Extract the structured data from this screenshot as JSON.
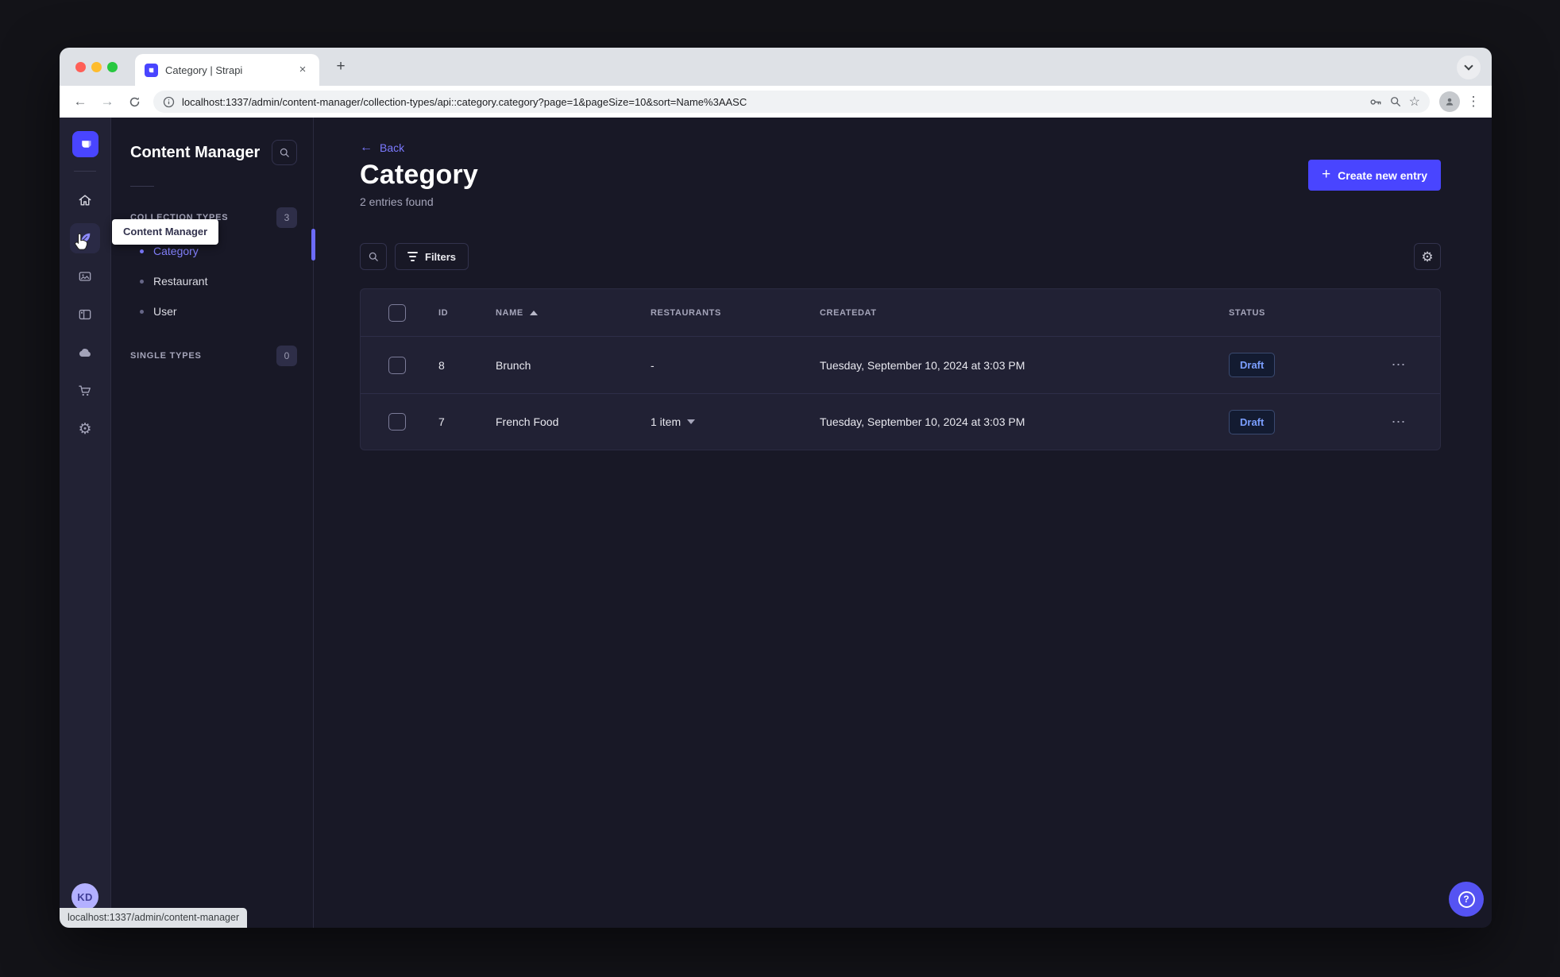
{
  "browser": {
    "tab_title": "Category | Strapi",
    "url": "localhost:1337/admin/content-manager/collection-types/api::category.category?page=1&pageSize=10&sort=Name%3AASC",
    "status_bar": "localhost:1337/admin/content-manager"
  },
  "icons": {
    "close": "×",
    "new_tab": "+",
    "back": "←",
    "forward": "→",
    "star": "☆",
    "more_vertical": "⋮",
    "more_horizontal": "⋯",
    "gear": "⚙",
    "plus": "+",
    "back_link_arrow": "←",
    "help": "?"
  },
  "subnav": {
    "title": "Content Manager",
    "tooltip": "Content Manager",
    "collection_types_label": "COLLECTION TYPES",
    "collection_types_count": "3",
    "items": [
      {
        "label": "Category"
      },
      {
        "label": "Restaurant"
      },
      {
        "label": "User"
      }
    ],
    "single_types_label": "SINGLE TYPES",
    "single_types_count": "0"
  },
  "main": {
    "back_label": "Back",
    "title": "Category",
    "subtitle": "2 entries found",
    "create_button": "Create new entry",
    "filters_button": "Filters"
  },
  "table": {
    "sorted_column": "NAME",
    "sorted_direction": "asc",
    "headers": {
      "id": "ID",
      "name": "NAME",
      "restaurants": "RESTAURANTS",
      "createdat": "CREATEDAT",
      "status": "STATUS"
    },
    "rows": [
      {
        "id": "8",
        "name": "Brunch",
        "restaurants": "-",
        "created": "Tuesday, September 10, 2024 at 3:03 PM",
        "status": "Draft"
      },
      {
        "id": "7",
        "name": "French Food",
        "restaurants": "1 item",
        "created": "Tuesday, September 10, 2024 at 3:03 PM",
        "status": "Draft"
      }
    ]
  },
  "user": {
    "initials": "KD"
  },
  "colors": {
    "accent": "#4945ff",
    "accent_light": "#7b79ff",
    "page_bg": "#181826",
    "card_bg": "#212134",
    "draft_text": "#7b9fff"
  }
}
